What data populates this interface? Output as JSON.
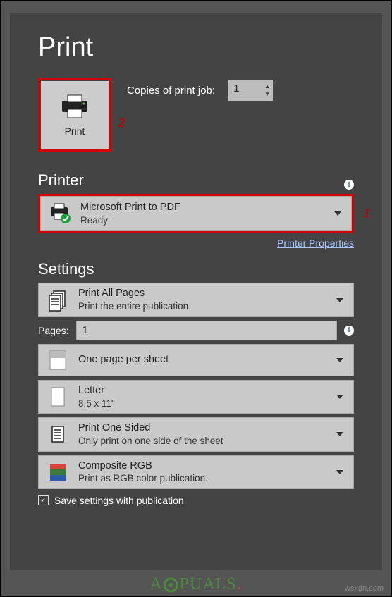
{
  "page": {
    "title": "Print"
  },
  "print_button": {
    "label": "Print"
  },
  "copies": {
    "label": "Copies of print job:",
    "value": "1"
  },
  "callouts": {
    "one": "1",
    "two": "2"
  },
  "printer_section": {
    "heading": "Printer",
    "selected": {
      "name": "Microsoft Print to PDF",
      "status": "Ready"
    },
    "properties_link": "Printer Properties"
  },
  "settings_section": {
    "heading": "Settings",
    "print_range": {
      "title": "Print All Pages",
      "sub": "Print the entire publication"
    },
    "pages": {
      "label": "Pages:",
      "value": "1"
    },
    "layout": {
      "title": "One page per sheet"
    },
    "paper": {
      "title": "Letter",
      "sub": "8.5 x 11\""
    },
    "duplex": {
      "title": "Print One Sided",
      "sub": "Only print on one side of the sheet"
    },
    "color": {
      "title": "Composite RGB",
      "sub": "Print as RGB color publication."
    },
    "save_settings": {
      "label": "Save settings with publication",
      "checked": true
    }
  },
  "footer": {
    "logo": "APPUALS",
    "watermark": "wsxdn.com"
  },
  "info_glyph": "i",
  "check_glyph": "✓"
}
